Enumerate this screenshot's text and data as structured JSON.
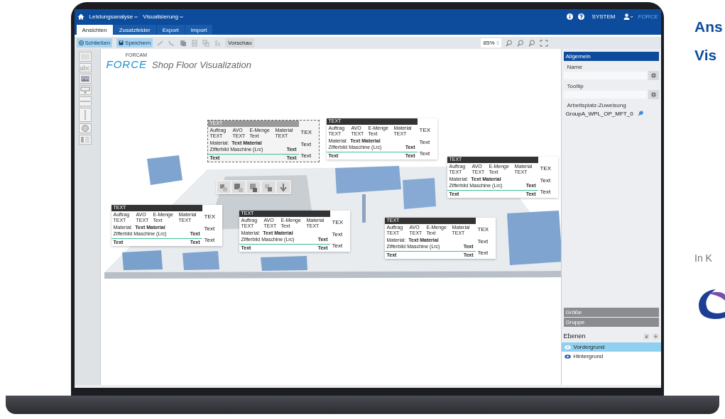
{
  "topbar": {
    "menus": [
      {
        "label": "Leistungsanalyse"
      },
      {
        "label": "Visualisierung"
      }
    ],
    "user": "SYSTEM",
    "brand": "FORCE"
  },
  "tabs": [
    {
      "label": "Ansichten",
      "selected": true
    },
    {
      "label": "Zusatzfelder",
      "selected": false
    },
    {
      "label": "Export",
      "selected": false
    },
    {
      "label": "Import",
      "selected": false
    }
  ],
  "toolbar": {
    "actions": [
      {
        "label": "Schließen"
      },
      {
        "label": "Speichern"
      }
    ],
    "tools": [
      {
        "disabled": true
      },
      {
        "disabled": true
      },
      {
        "disabled": true
      },
      {
        "disabled": true
      },
      {
        "disabled": true
      },
      {
        "disabled": true
      }
    ],
    "preview": "Vorschau",
    "zoom": "85%"
  },
  "palette": {
    "text_tool": "abc"
  },
  "canvas": {
    "brand_mark": "FORCAM",
    "brand": "FORCE",
    "title": "Shop Floor Visualization",
    "cards": [
      {
        "kind": "ghost",
        "header": "TEXT",
        "labels": [
          "Auftrag",
          "AVO",
          "E-Menge",
          "Material"
        ],
        "values": [
          "TEXT",
          "TEXT",
          "Text",
          "TEXT"
        ],
        "material": [
          "Material:",
          "Text Material"
        ],
        "machine": [
          "Zifferbild Maschine (Lrc)",
          "Text"
        ],
        "footer": [
          "Text",
          "Text"
        ],
        "side": [
          "TEX",
          "Text",
          "Text"
        ]
      },
      {
        "kind": "card",
        "header": "TEXT",
        "labels": [
          "Auftrag",
          "AVO",
          "E-Menge",
          "Material"
        ],
        "values": [
          "TEXT",
          "TEXT",
          "Text",
          "TEXT"
        ],
        "material": [
          "Material:",
          "Text Material"
        ],
        "machine": [
          "Zifferbild Maschine (Lrc)",
          "Text"
        ],
        "footer": [
          "Text",
          "Text"
        ],
        "side": [
          "TEX",
          "Text",
          "Text"
        ]
      },
      {
        "kind": "card",
        "header": "TEXT",
        "labels": [
          "Auftrag",
          "AVO",
          "E-Menge",
          "Material"
        ],
        "values": [
          "TEXT",
          "TEXT",
          "Text",
          "TEXT"
        ],
        "material": [
          "Material:",
          "Text Material"
        ],
        "machine": [
          "Zifferbild Maschine (Lrc)",
          "Text"
        ],
        "footer": [
          "Text",
          "Text"
        ],
        "side": [
          "TEX",
          "Text",
          "Text"
        ]
      },
      {
        "kind": "card",
        "header": "TEXT",
        "labels": [
          "Auftrag",
          "AVO",
          "E-Menge",
          "Material"
        ],
        "values": [
          "TEXT",
          "TEXT",
          "Text",
          "TEXT"
        ],
        "material": [
          "Material:",
          "Text Material"
        ],
        "machine": [
          "Zifferbild Maschine (Lrc)",
          "Text"
        ],
        "footer": [
          "Text",
          "Text"
        ],
        "side": [
          "TEX",
          "Text",
          "Text"
        ]
      },
      {
        "kind": "card",
        "header": "TEXT",
        "labels": [
          "Auftrag",
          "AVO",
          "E-Menge",
          "Material"
        ],
        "values": [
          "TEXT",
          "TEXT",
          "Text",
          "TEXT"
        ],
        "material": [
          "Material:",
          "Text Material"
        ],
        "machine": [
          "Zifferbild Maschine (Lrc)",
          "Text"
        ],
        "footer": [
          "Text",
          "Text"
        ],
        "side": [
          "TEX",
          "Text",
          "Text"
        ]
      },
      {
        "kind": "card",
        "header": "TEXT",
        "labels": [
          "Auftrag",
          "AVO",
          "E-Menge",
          "Material"
        ],
        "values": [
          "TEXT",
          "TEXT",
          "Text",
          "TEXT"
        ],
        "material": [
          "Material:",
          "Text Material"
        ],
        "machine": [
          "Zifferbild Maschine (Lrc)",
          "Text"
        ],
        "footer": [
          "Text",
          "Text"
        ],
        "side": [
          "TEX",
          "Text",
          "Text"
        ]
      }
    ]
  },
  "panel": {
    "header": "Allgemein",
    "fields": [
      {
        "label": "Name"
      },
      {
        "label": "Tooltip"
      }
    ],
    "assignment": {
      "label": "Arbeitsplatz-Zuweisung",
      "value": "GroupA_WPL_OP_MFT_0"
    },
    "sections": [
      "Größe",
      "Gruppe"
    ],
    "layers_title": "Ebenen",
    "layers": [
      {
        "label": "Vordergrund",
        "selected": true
      },
      {
        "label": "Hintergrund",
        "selected": false
      }
    ]
  },
  "promo": {
    "heading": [
      "Ans",
      "Vis"
    ],
    "text": "In K"
  }
}
